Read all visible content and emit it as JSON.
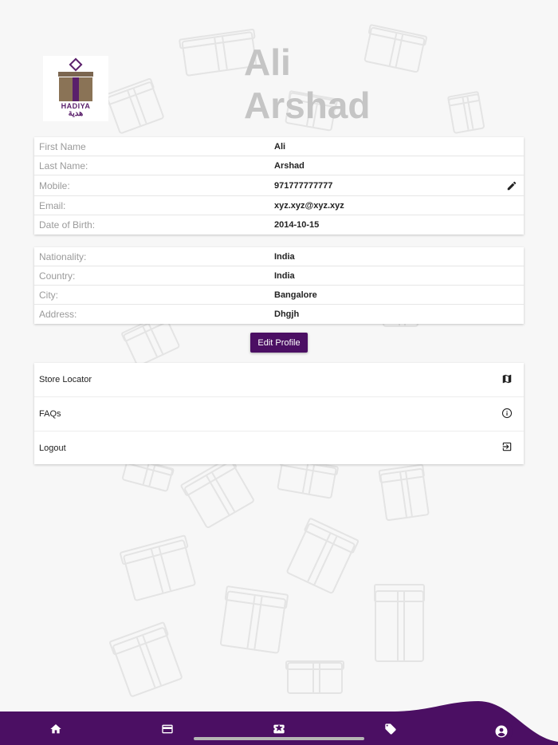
{
  "header": {
    "first_name_display": "Ali",
    "last_name_display": "Arshad"
  },
  "logo": {
    "brand": "HADIYA",
    "brand_ar": "هدية"
  },
  "profile": {
    "fields": [
      {
        "label": "First Name",
        "value": "Ali"
      },
      {
        "label": "Last Name:",
        "value": "Arshad"
      },
      {
        "label": "Mobile:",
        "value": "971777777777"
      },
      {
        "label": "Email:",
        "value": "xyz.xyz@xyz.xyz"
      },
      {
        "label": "Date of Birth:",
        "value": "2014-10-15"
      }
    ],
    "location": [
      {
        "label": "Nationality:",
        "value": "India"
      },
      {
        "label": "Country:",
        "value": "India"
      },
      {
        "label": "City:",
        "value": "Bangalore"
      },
      {
        "label": "Address:",
        "value": "Dhgjh"
      }
    ],
    "edit_label": "Edit Profile"
  },
  "menu": {
    "items": [
      {
        "label": "Store Locator",
        "icon": "map-icon"
      },
      {
        "label": "FAQs",
        "icon": "info-icon"
      },
      {
        "label": "Logout",
        "icon": "logout-icon"
      }
    ]
  },
  "bottom_nav": {
    "items": [
      "home-icon",
      "card-icon",
      "ticket-icon",
      "tag-icon",
      "account-icon"
    ],
    "active": "account-icon"
  },
  "colors": {
    "accent": "#4b0f63",
    "hero_text": "#c5c5c5",
    "background": "#f7f7f7"
  }
}
